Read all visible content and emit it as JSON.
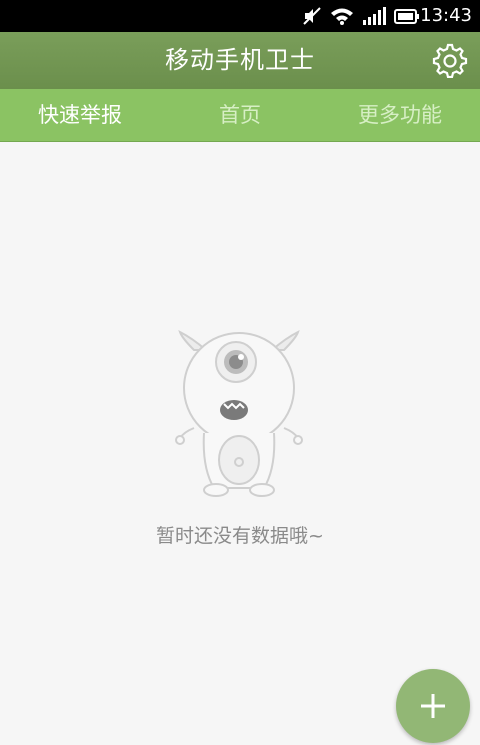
{
  "status_bar": {
    "time": "13:43",
    "icons": [
      "mute-icon",
      "wifi-icon",
      "signal-icon",
      "battery-icon"
    ]
  },
  "app_bar": {
    "title": "移动手机卫士",
    "settings_icon": "gear-icon"
  },
  "tabs": [
    {
      "label": "快速举报",
      "active": true
    },
    {
      "label": "首页",
      "active": false
    },
    {
      "label": "更多功能",
      "active": false
    }
  ],
  "empty_state": {
    "illustration": "one-eyed-monster",
    "message": "暂时还没有数据哦~"
  },
  "fab": {
    "icon": "plus-icon"
  },
  "colors": {
    "app_bar": "#6f9350",
    "tab_bar": "#8bc363",
    "active_tab_text": "#ffffff",
    "inactive_tab_text": "#d7efc5",
    "background": "#f6f6f6",
    "fab": "#92b775"
  }
}
